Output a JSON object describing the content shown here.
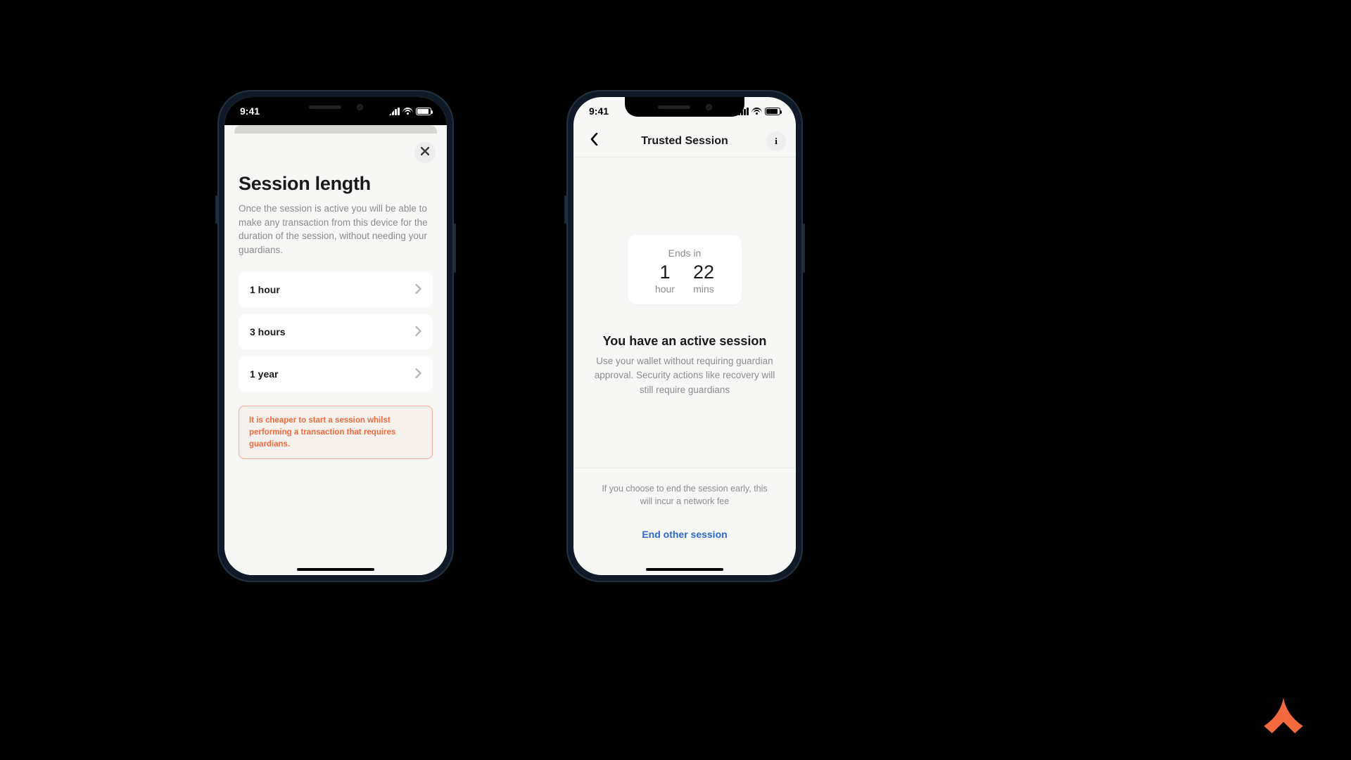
{
  "statusbar": {
    "time": "9:41"
  },
  "screen_left": {
    "title": "Session length",
    "intro": "Once the session is active you will be able to make any transaction from this device for the duration of the session, without needing your guardians.",
    "options": [
      {
        "label": "1 hour"
      },
      {
        "label": "3 hours"
      },
      {
        "label": "1 year"
      }
    ],
    "note": "It is cheaper to start a session whilst performing a transaction that requires guardians."
  },
  "screen_right": {
    "header_title": "Trusted Session",
    "ends_label": "Ends in",
    "countdown": {
      "hour_value": "1",
      "hour_unit": "hour",
      "mins_value": "22",
      "mins_unit": "mins"
    },
    "active_heading": "You have an active session",
    "active_body": "Use your wallet without requiring guardian approval. Security actions like recovery will still require guardians",
    "footer_note": "If you choose to end the session early, this will incur a network fee",
    "end_link": "End other session"
  },
  "colors": {
    "accent_orange": "#f36a3e",
    "link_blue": "#2a68d6"
  }
}
